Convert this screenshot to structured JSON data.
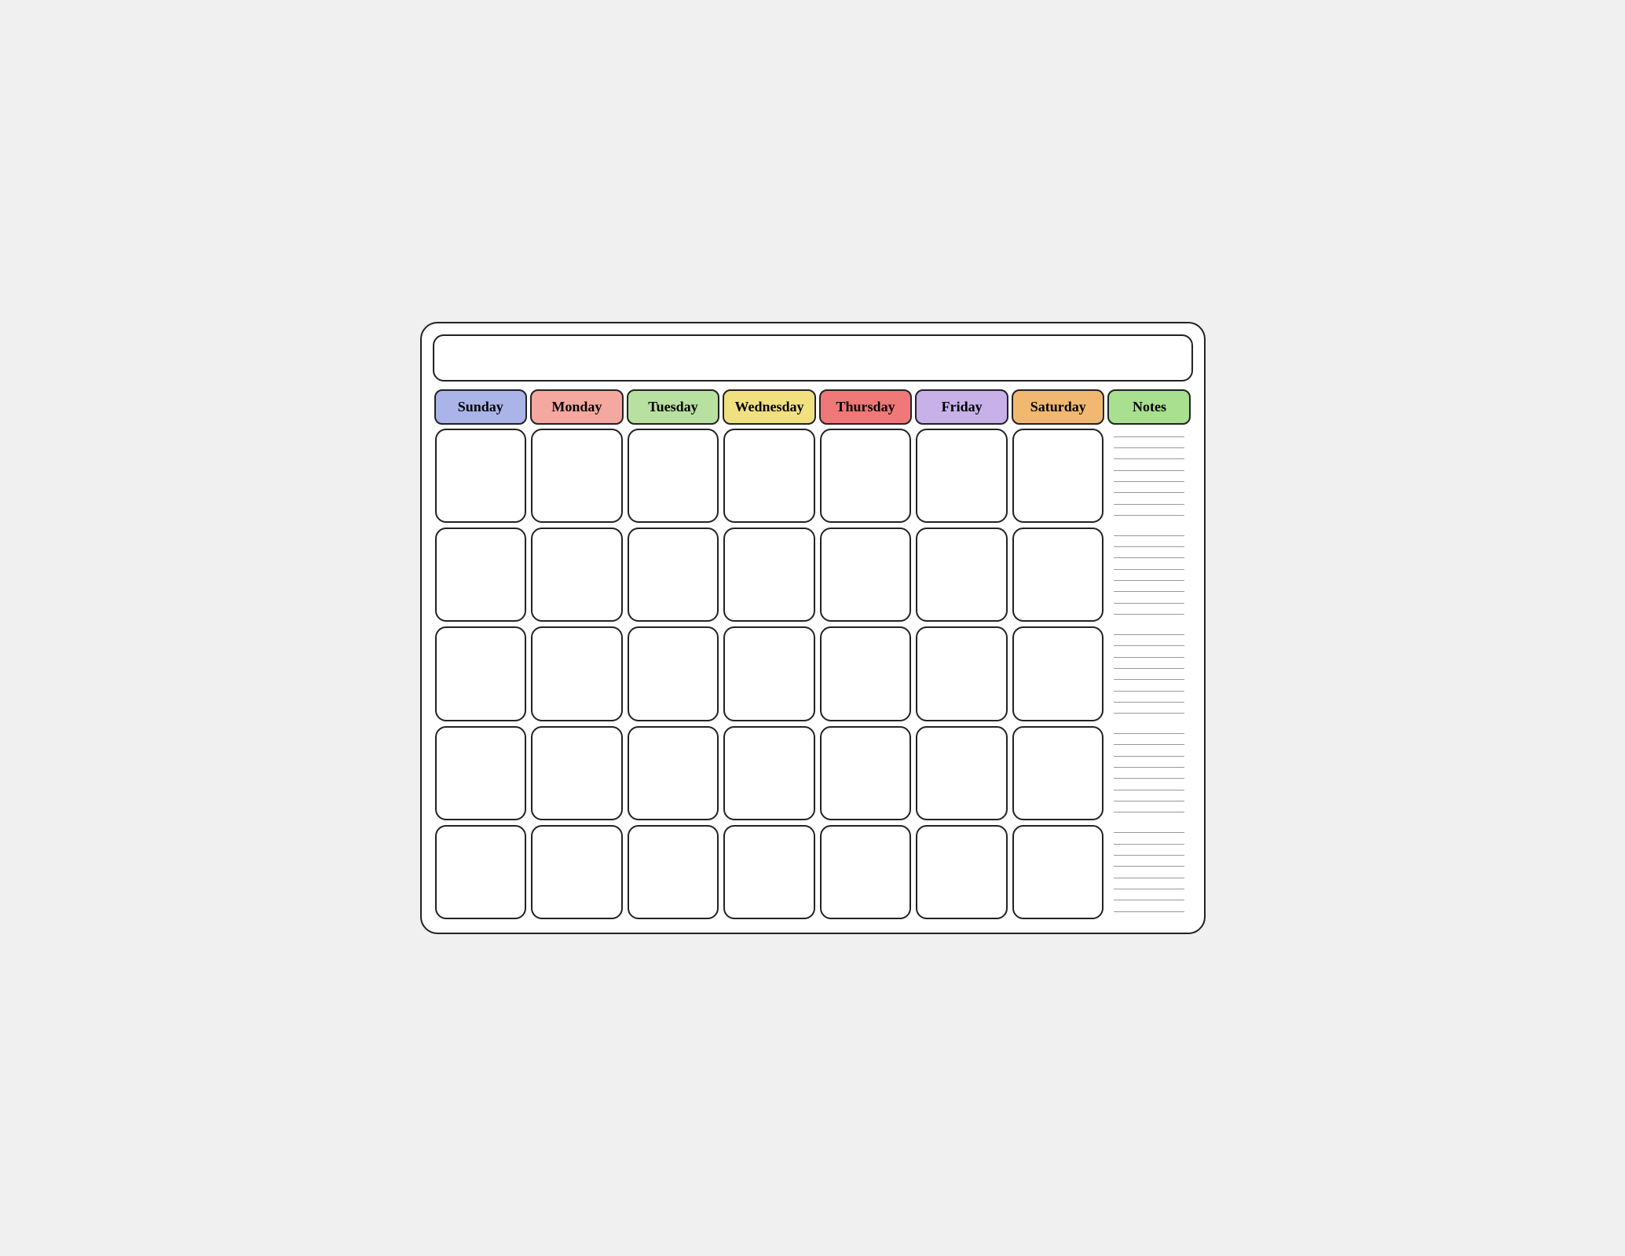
{
  "calendar": {
    "title": "",
    "days": [
      "Sunday",
      "Monday",
      "Tuesday",
      "Wednesday",
      "Thursday",
      "Friday",
      "Saturday"
    ],
    "notes_label": "Notes",
    "header_colors": {
      "sunday": "header-sunday",
      "monday": "header-monday",
      "tuesday": "header-tuesday",
      "wednesday": "header-wednesday",
      "thursday": "header-thursday",
      "friday": "header-friday",
      "saturday": "header-saturday",
      "notes": "header-notes"
    },
    "rows": 5,
    "notes_lines": 40
  }
}
